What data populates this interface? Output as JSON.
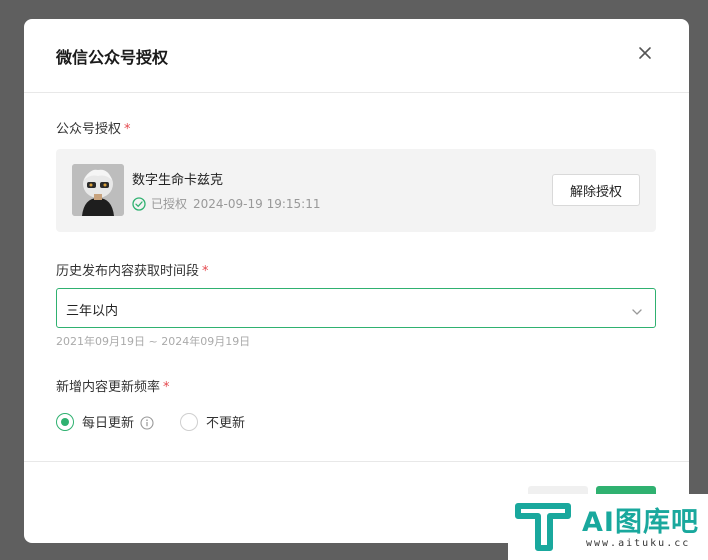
{
  "dialog": {
    "title": "微信公众号授权",
    "close_icon": "close-icon"
  },
  "authorization": {
    "label": "公众号授权",
    "required_mark": "*",
    "account": {
      "name": "数字生命卡兹克",
      "status": "已授权",
      "authorized_at": "2024-09-19 19:15:11",
      "status_icon": "check-circle-icon"
    },
    "revoke_label": "解除授权"
  },
  "history": {
    "label": "历史发布内容获取时间段",
    "required_mark": "*",
    "selected": "三年以内",
    "range_hint": "2021年09月19日 ~ 2024年09月19日"
  },
  "frequency": {
    "label": "新增内容更新频率",
    "required_mark": "*",
    "options": [
      {
        "label": "每日更新",
        "checked": true
      },
      {
        "label": "不更新",
        "checked": false
      }
    ]
  },
  "watermark": {
    "text": "AI图库吧",
    "url": "www.aituku.cc"
  },
  "colors": {
    "accent": "#2fb170",
    "required": "#e5484d",
    "overlay": "#5f5f5f"
  }
}
